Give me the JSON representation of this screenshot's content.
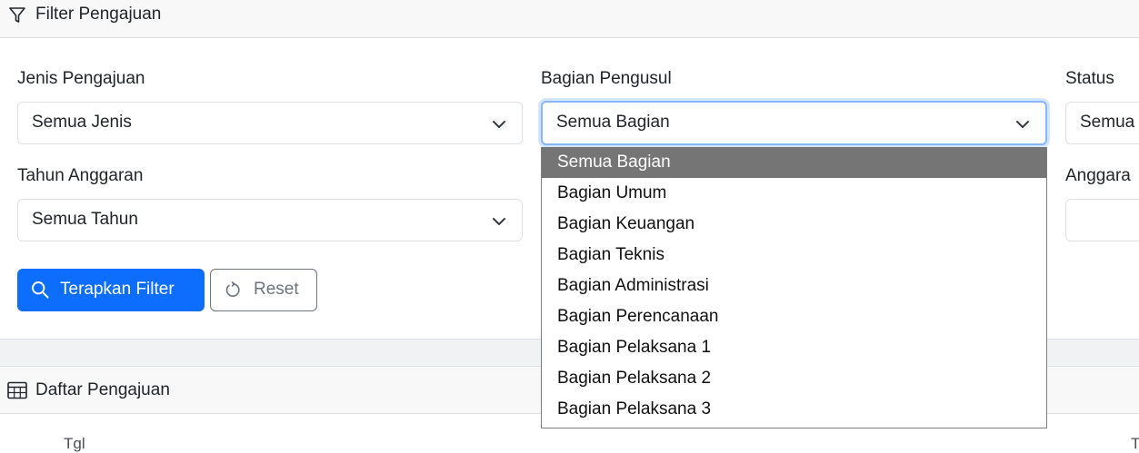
{
  "filter_card": {
    "title": "Filter Pengajuan",
    "fields": {
      "jenis": {
        "label": "Jenis Pengajuan",
        "value": "Semua Jenis"
      },
      "bagian": {
        "label": "Bagian Pengusul",
        "value": "Semua Bagian"
      },
      "status": {
        "label": "Status",
        "value": "Semua"
      },
      "tahun": {
        "label": "Tahun Anggaran",
        "value": "Semua Tahun"
      },
      "anggaran": {
        "label": "Anggara",
        "value": ""
      }
    },
    "apply_button": "Terapkan Filter",
    "reset_button": "Reset"
  },
  "bagian_dropdown": {
    "options": [
      "Semua Bagian",
      "Bagian Umum",
      "Bagian Keuangan",
      "Bagian Teknis",
      "Bagian Administrasi",
      "Bagian Perencanaan",
      "Bagian Pelaksana 1",
      "Bagian Pelaksana 2",
      "Bagian Pelaksana 3"
    ],
    "selected_index": 0
  },
  "list_card": {
    "title": "Daftar Pengajuan",
    "columns": [
      "Tgl",
      "T"
    ]
  },
  "colors": {
    "primary": "#0d6efd",
    "secondary": "#6c757d",
    "focus_ring": "#86b7fe",
    "dropdown_selected": "#757575"
  },
  "icons": {
    "filter": "funnel-icon",
    "search": "search-icon",
    "reset": "rotate-icon",
    "table": "table-icon",
    "chevron": "chevron-down-icon"
  }
}
